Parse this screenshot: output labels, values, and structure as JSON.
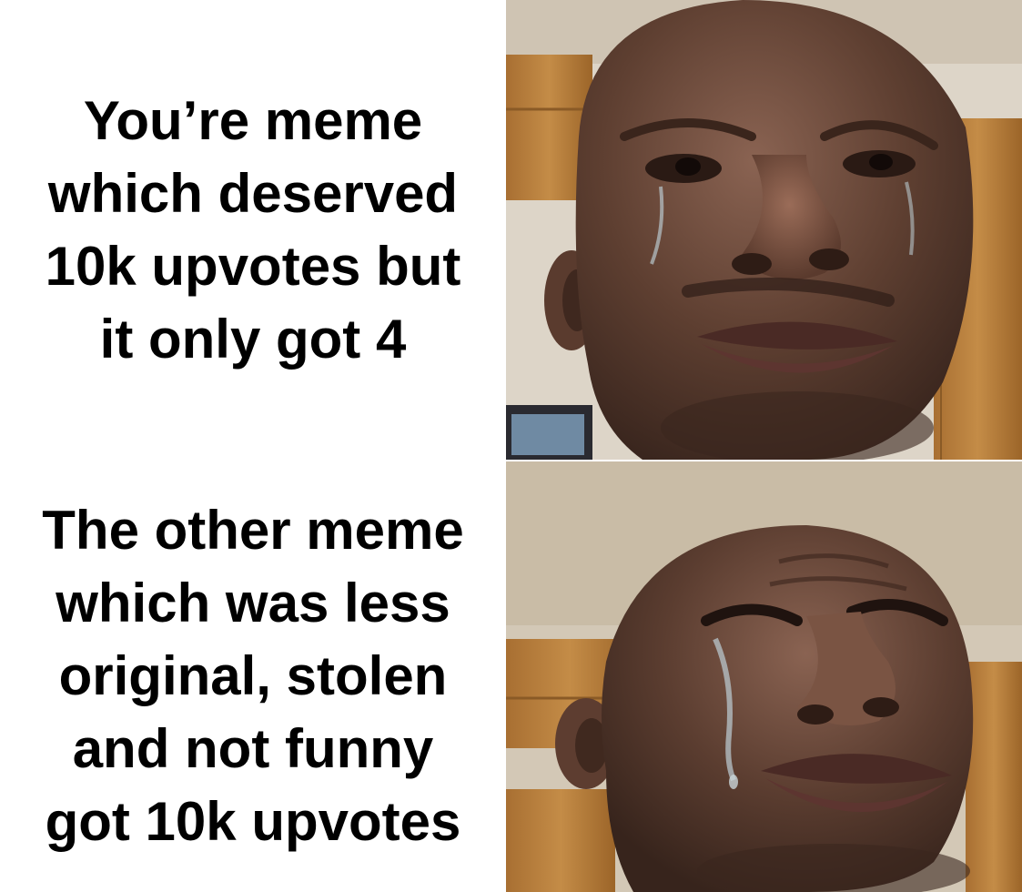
{
  "meme": {
    "top_caption": {
      "lines": [
        "You’re meme",
        "which deserved",
        "10k upvotes but",
        "it only got 4"
      ]
    },
    "bottom_caption": {
      "lines": [
        "The other meme",
        "which was less",
        "original, stolen",
        "and not funny",
        "got 10k upvotes"
      ]
    },
    "panels": {
      "top": {
        "expression": "teary-eyed"
      },
      "bottom": {
        "expression": "sobbing"
      }
    },
    "colors": {
      "background": "#ffffff",
      "text": "#000000",
      "skin": "#6b4a3a",
      "wood": "#b9813e",
      "wall": "#d7cfc2"
    }
  }
}
